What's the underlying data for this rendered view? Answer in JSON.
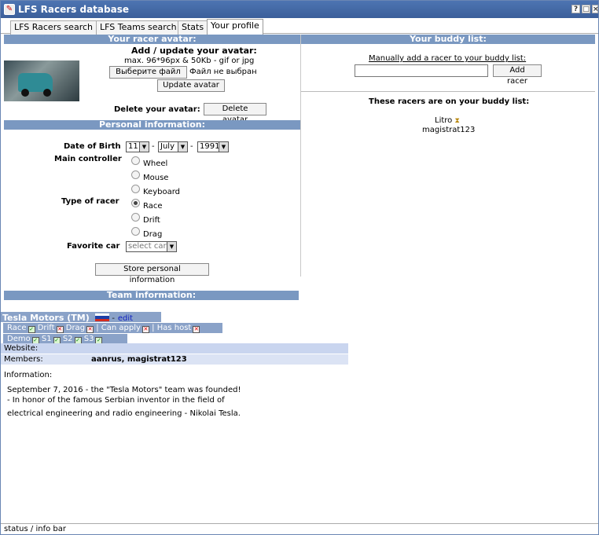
{
  "window": {
    "title": "LFS Racers database",
    "controls": [
      "?",
      "□",
      "×"
    ]
  },
  "tabs": [
    {
      "label": "LFS Racers search"
    },
    {
      "label": "LFS Teams search"
    },
    {
      "label": "Stats"
    },
    {
      "label": "Your profile",
      "active": true
    }
  ],
  "avatar": {
    "header": "Your racer avatar:",
    "add_title": "Add / update your avatar:",
    "limits": "max. 96*96px & 50Kb - gif or jpg",
    "choose_file_label": "Выберите файл",
    "no_file_text": "Файл не выбран",
    "update_label": "Update avatar",
    "delete_text": "Delete your avatar:",
    "delete_label": "Delete avatar"
  },
  "personal": {
    "header": "Personal information:",
    "dob_label": "Date of Birth",
    "dob_day": "11",
    "dob_month": "July",
    "dob_year": "1991",
    "dob_sep": "-",
    "controller_label": "Main controller",
    "controllers": [
      "Wheel",
      "Mouse",
      "Keyboard"
    ],
    "type_label": "Type of racer",
    "types": [
      "Race",
      "Drift",
      "Drag"
    ],
    "selected_type": "Race",
    "car_label": "Favorite car",
    "car_placeholder": "select car",
    "store_label": "Store personal information"
  },
  "buddy": {
    "header": "Your buddy list:",
    "add_text": "Manually add a racer to your buddy list:",
    "add_label": "Add racer",
    "list_title": "These racers are on your buddy list:",
    "racers": [
      "Litro",
      "magistrat123"
    ]
  },
  "team": {
    "header": "Team information:",
    "name": "Tesla Motors",
    "tag": "(TM)",
    "edit_label": "edit",
    "edit_prefix": "-",
    "race_label": "Race",
    "drift_label": "Drift",
    "drag_label": "Drag",
    "can_apply_label": "Can apply",
    "has_host_label": "Has host",
    "separator": "|",
    "demo_label": "Demo",
    "s1_label": "S1",
    "s2_label": "S2",
    "s3_label": "S3",
    "website_label": "Website:",
    "members_label": "Members:",
    "members": "aanrus, magistrat123",
    "info_label": "Information:",
    "info_lines": [
      "September 7, 2016 - the \"Tesla Motors\" team was founded!",
      "- In honor of the famous Serbian inventor in the field of",
      "electrical engineering and radio engineering - Nikolai Tesla."
    ],
    "flags": {
      "race": true,
      "drift": false,
      "drag": false,
      "can_apply": false,
      "has_host": false,
      "demo": true,
      "s1": true,
      "s2": true,
      "s3": true
    },
    "flag_colors": [
      "#ffffff",
      "#1c3fa8",
      "#d52b1e"
    ]
  },
  "status_bar": "status / info bar",
  "colors": {
    "accent": "#7a98c1",
    "titlebar": "#4066a6"
  }
}
